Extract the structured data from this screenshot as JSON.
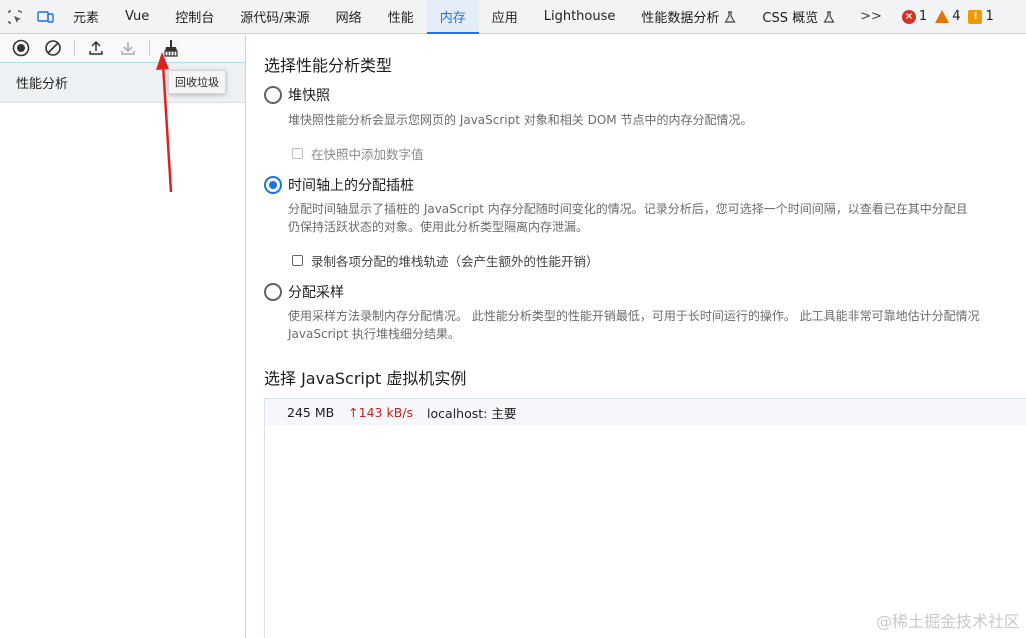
{
  "tabs": [
    {
      "label": "元素",
      "active": false,
      "flask": false
    },
    {
      "label": "Vue",
      "active": false,
      "flask": false
    },
    {
      "label": "控制台",
      "active": false,
      "flask": false
    },
    {
      "label": "源代码/来源",
      "active": false,
      "flask": false
    },
    {
      "label": "网络",
      "active": false,
      "flask": false
    },
    {
      "label": "性能",
      "active": false,
      "flask": false
    },
    {
      "label": "内存",
      "active": true,
      "flask": false
    },
    {
      "label": "应用",
      "active": false,
      "flask": false
    },
    {
      "label": "Lighthouse",
      "active": false,
      "flask": false
    },
    {
      "label": "性能数据分析",
      "active": false,
      "flask": true
    },
    {
      "label": "CSS 概览",
      "active": false,
      "flask": true
    }
  ],
  "more_label": ">>",
  "status": {
    "errors": "1",
    "warnings": "4",
    "info": "1"
  },
  "toolbar": {
    "icons": [
      "record-icon",
      "clear-icon",
      "upload-icon",
      "download-icon",
      "collect-garbage-icon"
    ],
    "tooltip": "回收垃圾"
  },
  "sidebar": {
    "item": "性能分析"
  },
  "main": {
    "title": "选择性能分析类型",
    "options": [
      {
        "label": "堆快照",
        "selected": false,
        "desc": [
          "堆快照性能分析会显示您网页的 JavaScript 对象和相关 DOM 节点中的内存分配情况。"
        ],
        "checkbox": {
          "label": "在快照中添加数字值",
          "enabled": false
        }
      },
      {
        "label": "时间轴上的分配插桩",
        "selected": true,
        "desc": [
          "分配时间轴显示了插桩的 JavaScript 内存分配随时间变化的情况。记录分析后，您可选择一个时间间隔，以查看已在其中分配且",
          "仍保持活跃状态的对象。使用此分析类型隔离内存泄漏。"
        ],
        "checkbox": {
          "label": "录制各项分配的堆栈轨迹（会产生额外的性能开销）",
          "enabled": true
        }
      },
      {
        "label": "分配采样",
        "selected": false,
        "desc": [
          "使用采样方法录制内存分配情况。 此性能分析类型的性能开销最低，可用于长时间运行的操作。 此工具能非常可靠地估计分配情况",
          "JavaScript 执行堆栈细分结果。"
        ],
        "checkbox": null
      }
    ],
    "vm_title": "选择 JavaScript 虚拟机实例",
    "vm": {
      "size": "245 MB",
      "rate": "↑143 kB/s",
      "target": "localhost: 主要"
    }
  },
  "watermark": "@稀土掘金技术社区",
  "colors": {
    "accent": "#1a73e8",
    "annotation_arrow": "#e02020",
    "rate": "#c5221f"
  }
}
